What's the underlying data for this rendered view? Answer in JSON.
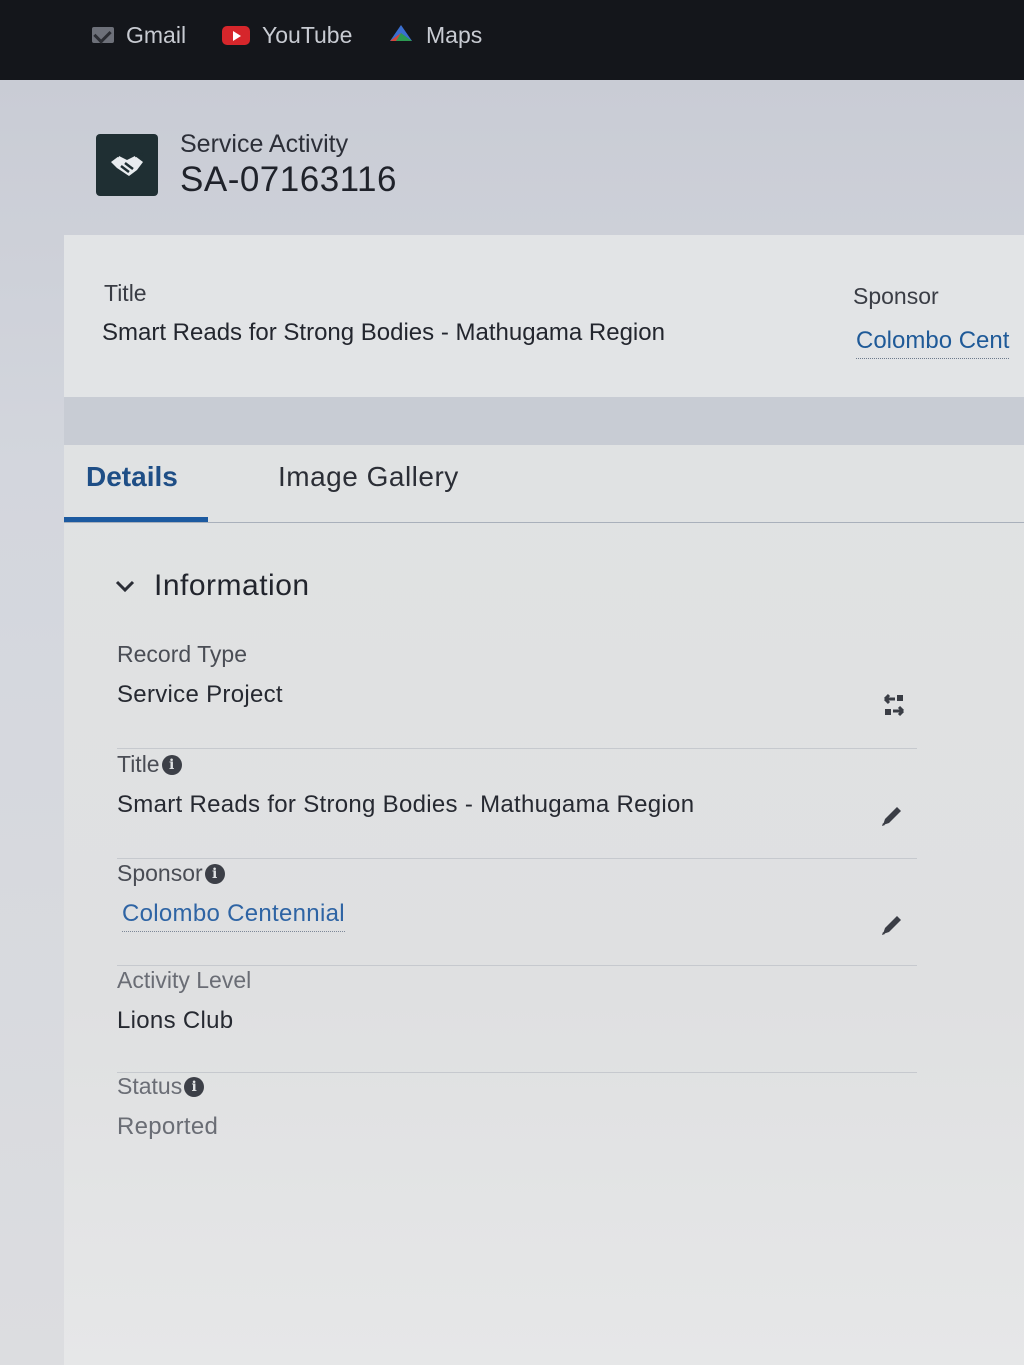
{
  "bookmarks": [
    {
      "label": "Gmail",
      "icon": "gmail-icon"
    },
    {
      "label": "YouTube",
      "icon": "youtube-icon"
    },
    {
      "label": "Maps",
      "icon": "maps-icon"
    }
  ],
  "record": {
    "object_label": "Service Activity",
    "name": "SA-07163116",
    "icon": "handshake-icon"
  },
  "highlights": {
    "title_label": "Title",
    "title_value": "Smart Reads for Strong Bodies - Mathugama Region",
    "sponsor_label": "Sponsor",
    "sponsor_value": "Colombo Cent"
  },
  "tabs": [
    {
      "label": "Details",
      "active": true
    },
    {
      "label": "Image Gallery",
      "active": false
    }
  ],
  "section": {
    "title": "Information",
    "fields": [
      {
        "label": "Record Type",
        "value": "Service Project",
        "action": "change-record-type-icon"
      },
      {
        "label": "Title",
        "value": "Smart Reads for Strong Bodies - Mathugama Region",
        "info": "i",
        "action": "edit-pencil-icon"
      },
      {
        "label": "Sponsor",
        "value": "Colombo Centennial",
        "info": "i",
        "action": "edit-pencil-icon"
      },
      {
        "label": "Activity Level",
        "value": "Lions Club"
      },
      {
        "label": "Status",
        "value": "Reported",
        "info": "i"
      }
    ]
  },
  "colors": {
    "accent": "#1c5aa0",
    "link": "#2e64a4",
    "bookmark_bar": "#14161b"
  }
}
